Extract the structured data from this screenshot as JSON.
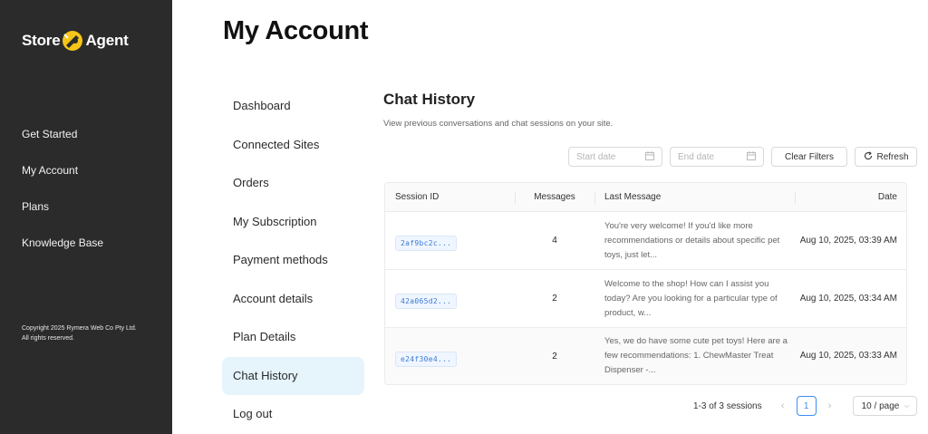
{
  "brand": {
    "part1": "Store",
    "part2": "Agent"
  },
  "sidebar": {
    "items": [
      {
        "label": "Get Started"
      },
      {
        "label": "My Account"
      },
      {
        "label": "Plans"
      },
      {
        "label": "Knowledge Base"
      }
    ],
    "copyright_line1": "Copyright 2025 Rymera Web Co Pty Ltd.",
    "copyright_line2": "All rights reserved."
  },
  "page": {
    "title": "My Account"
  },
  "account_nav": {
    "items": [
      {
        "label": "Dashboard"
      },
      {
        "label": "Connected Sites"
      },
      {
        "label": "Orders"
      },
      {
        "label": "My Subscription"
      },
      {
        "label": "Payment methods"
      },
      {
        "label": "Account details"
      },
      {
        "label": "Plan Details"
      },
      {
        "label": "Chat History",
        "active": true
      },
      {
        "label": "Log out"
      }
    ]
  },
  "chat_history": {
    "title": "Chat History",
    "subtitle": "View previous conversations and chat sessions on your site.",
    "filters": {
      "start_placeholder": "Start date",
      "end_placeholder": "End date",
      "clear_label": "Clear Filters",
      "refresh_label": "Refresh"
    },
    "columns": {
      "session": "Session ID",
      "messages": "Messages",
      "last": "Last Message",
      "date": "Date"
    },
    "rows": [
      {
        "session_id": "2af9bc2c...",
        "messages": "4",
        "last_message": "You're very welcome! If you'd like more recommendations or details about specific pet toys, just let...",
        "date": "Aug 10, 2025, 03:39 AM"
      },
      {
        "session_id": "42a065d2...",
        "messages": "2",
        "last_message": "Welcome to the shop! How can I assist you today? Are you looking for a particular type of product, w...",
        "date": "Aug 10, 2025, 03:34 AM"
      },
      {
        "session_id": "e24f30e4...",
        "messages": "2",
        "last_message": "Yes, we do have some cute pet toys! Here are a few recommendations: 1. ChewMaster Treat Dispenser -...",
        "date": "Aug 10, 2025, 03:33 AM"
      }
    ],
    "pagination": {
      "total_text": "1-3 of 3 sessions",
      "current_page": "1",
      "page_size": "10 / page"
    }
  },
  "colors": {
    "sidebar_bg": "#2b2b2b",
    "active_nav_bg": "#e6f4fc",
    "accent": "#3b8ff0",
    "logo_yellow": "#f5c518"
  }
}
